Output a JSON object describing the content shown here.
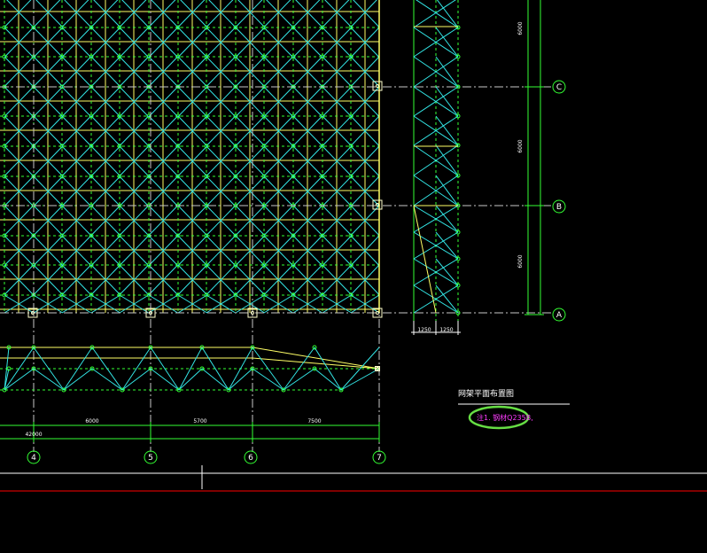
{
  "drawing": {
    "title": "网架平面布置图",
    "note": "注1. 钢材Q235B,",
    "axes": {
      "rows": [
        "C",
        "B",
        "A"
      ],
      "columns": [
        "4",
        "5",
        "6",
        "7"
      ]
    },
    "dimensions": {
      "bottom": [
        "6000",
        "5700",
        "7500"
      ],
      "bottom_total": "42000",
      "right": [
        "6000",
        "6000",
        "6000"
      ],
      "side_section": [
        "1250",
        "1250"
      ]
    },
    "colors": {
      "background": "#000000",
      "chord_yellow": "#ffff66",
      "web_cyan": "#33e6e6",
      "dashed_green": "#33ff33",
      "axis_grey": "#c8c8c8",
      "red_line": "#ff0000",
      "note_magenta": "#ff3cff",
      "highlight_ellipse": "#66dd44"
    }
  }
}
